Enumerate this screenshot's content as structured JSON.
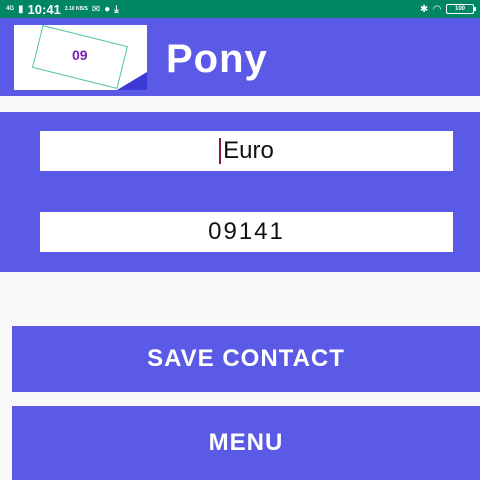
{
  "status_bar": {
    "network": "4G",
    "time": "10:41",
    "speed": "3.10 KB/S",
    "battery": "100"
  },
  "app_bar": {
    "logo_text": "09",
    "title": "Pony"
  },
  "form": {
    "name_value": "Euro",
    "phone_value": "09141"
  },
  "buttons": {
    "save_label": "SAVE CONTACT",
    "menu_label": "MENU"
  },
  "colors": {
    "primary": "#5b5ae6",
    "status_bar": "#008565",
    "background": "#f8f8f8"
  }
}
